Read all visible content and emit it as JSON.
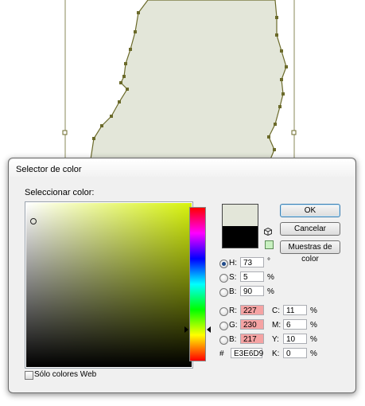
{
  "dialog": {
    "title": "Selector de color",
    "select_label": "Seleccionar color:",
    "buttons": {
      "ok": "OK",
      "cancel": "Cancelar",
      "swatches": "Muestras de color"
    },
    "fields": {
      "h": {
        "label": "H:",
        "value": "73",
        "unit": "°",
        "selected": true
      },
      "s": {
        "label": "S:",
        "value": "5",
        "unit": "%"
      },
      "b": {
        "label": "B:",
        "value": "90",
        "unit": "%"
      },
      "r": {
        "label": "R:",
        "value": "227"
      },
      "g": {
        "label": "G:",
        "value": "230"
      },
      "b2": {
        "label": "B:",
        "value": "217"
      },
      "c": {
        "label": "C:",
        "value": "11",
        "unit": "%"
      },
      "m": {
        "label": "M:",
        "value": "6",
        "unit": "%"
      },
      "y": {
        "label": "Y:",
        "value": "10",
        "unit": "%"
      },
      "k": {
        "label": "K:",
        "value": "0",
        "unit": "%"
      },
      "hex": {
        "label": "#",
        "value": "E3E6D9"
      }
    },
    "web_only_label": "Sólo colores Web",
    "colors": {
      "new_color": "#e3e6d9",
      "current_color": "#000000",
      "hue_color": "#d7f30b",
      "out_of_gamut": "#f5a3a3"
    }
  },
  "canvas": {
    "shape_fill": "#e3e6d9",
    "shape_stroke": "#6b6a2a"
  }
}
